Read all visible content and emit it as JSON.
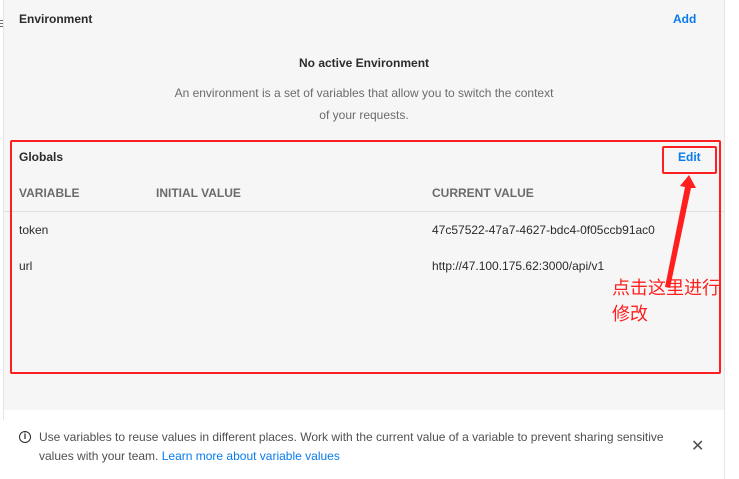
{
  "environment": {
    "title": "Environment",
    "add_label": "Add",
    "empty_title": "No active Environment",
    "empty_description": "An environment is a set of variables that allow you to switch the context of your requests."
  },
  "globals": {
    "title": "Globals",
    "edit_label": "Edit",
    "columns": [
      "VARIABLE",
      "INITIAL VALUE",
      "CURRENT VALUE"
    ],
    "rows": [
      {
        "variable": "token",
        "initial_value": "",
        "current_value": "47c57522-47a7-4627-bdc4-0f05ccb91ac0"
      },
      {
        "variable": "url",
        "initial_value": "",
        "current_value": "http://47.100.175.62:3000/api/v1"
      }
    ]
  },
  "annotation": {
    "text": "点击这里进行修改",
    "color": "#ff1f1f"
  },
  "footer": {
    "text": "Use variables to reuse values in different places. Work with the current value of a variable to prevent sharing sensitive values with your team.",
    "link_label": "Learn more about variable values",
    "info_icon": "info-icon",
    "close_icon": "close-icon"
  },
  "colors": {
    "accent": "#097bed",
    "panel_bg": "#f6f6f6",
    "annotation": "#ff1f1f"
  }
}
